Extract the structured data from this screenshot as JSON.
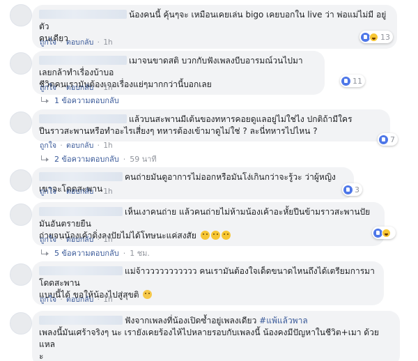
{
  "action_labels": {
    "like": "ถูกใจ",
    "reply": "ตอบกลับ",
    "separator": "·"
  },
  "comments": [
    {
      "text_lines": [
        "น้องคนนี้ คุ้นๆจะ เหมือนเคยเล่น bigo เคยบอกใน live ว่า พ่อแม่ไม่มี อยู่ตัว",
        "คนเดียว"
      ],
      "time": "1h",
      "reaction_count": "13",
      "reactions": [
        "like",
        "haha"
      ]
    },
    {
      "text_lines": [
        "เมาจนขาดสติ บวกกับฟังเพลงบีบอารมณ์วนไปมา เลยกล้าทำเรื่องบ้าบอ",
        "ชีวิตคนเรามันต้องเจอเรื่องแย่ๆมากกว่านี้บอกเลย"
      ],
      "time": "1h",
      "reaction_count": "11",
      "reactions": [
        "like"
      ],
      "replies_label": "1 ข้อความตอบกลับ"
    },
    {
      "text_lines": [
        "แล้วบนสะพานมีเต้นของทหารคอยดูแลอยู่ไม่ใช่ไง ปกติถ้ามีใคร",
        "ปีนราวสะพานหรือทำอะไรเสี่ยงๆ ทหารต้องเข้ามาดูไม่ใช่ ? ละนี่ทหารไปไหน ?"
      ],
      "time": "1h",
      "reaction_count": "7",
      "reactions": [
        "like"
      ],
      "replies_label": "2 ข้อความตอบกลับ",
      "replies_time": "59 นาที"
    },
    {
      "text_lines": [
        "คนถ่ายมันดูอาการไม่ออกหรือมันโง่เกินกว่าจะรู้วะ ว่าผู้หญิงเขาจะโดดสะพาน"
      ],
      "time": "1h",
      "reaction_count": "3",
      "reactions": [
        "like"
      ]
    },
    {
      "text_lines": [
        "เห็นเงาคนถ่าย แล้วคนถ่ายไม่ห้ามน้องเค้าอะหั้ยปีนข้ามราวสะพานปัยมันอันตรายยืน",
        "ถ่ายจนน้องเค้าดิ่งลงปัยไม่ได้โทษนะแค่สงสัย"
      ],
      "time": "1h",
      "reaction_count": "",
      "reactions": [
        "like",
        "haha"
      ],
      "replies_label": "5 ข้อความตอบกลับ",
      "replies_time": "1 ชม."
    },
    {
      "text_lines": [
        "แม่จ้าววววววววววว คนเรามันต้องใจเด็ดขนาดไหนถึงได้เตรียมการมาโดดสะพาน",
        "แบบนี้ได้ ขอให้น้องไปสู่สุขติ"
      ],
      "time": "1h",
      "reaction_count": "",
      "reactions": []
    },
    {
      "text_lines": [
        "ฟังจากเพลงที่น้องเปิดซ้ำอยู่เพลงเดียว",
        "เพลงนี้มันเศร้าจริงๆ นะ เรายังเคยร้องไห้ไปหลายรอบกับเพลงนี้ น้องคงมีปัญหาในชีวิต+เมา ด้วยแหล",
        "ะ"
      ],
      "hashtag": "#แพ้แล้วพาล"
    }
  ]
}
